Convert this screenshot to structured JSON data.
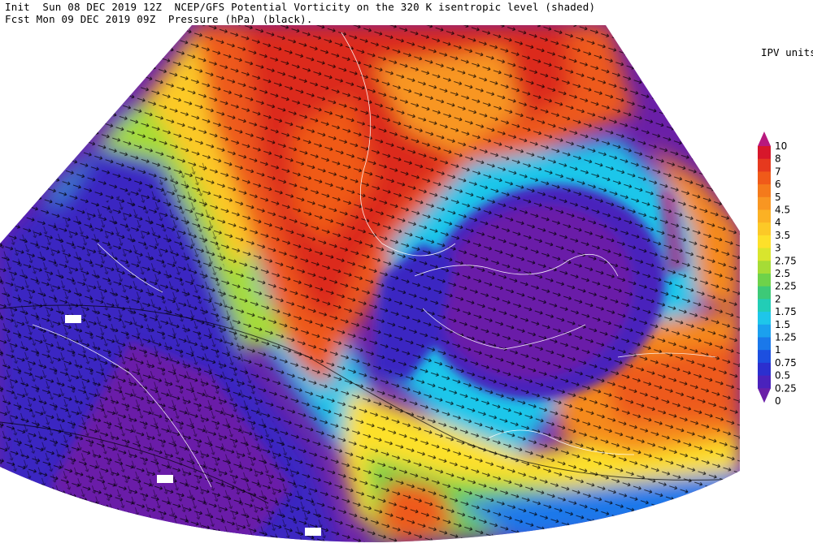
{
  "header": {
    "line1": "Init  Sun 08 DEC 2019 12Z  NCEP/GFS Potential Vorticity on the 320 K isentropic level (shaded)",
    "line2": "Fcst Mon 09 DEC 2019 09Z  Pressure (hPa) (black)."
  },
  "colorbar": {
    "units_label": "IPV units",
    "levels": [
      {
        "label": "10",
        "color": "#b8197e"
      },
      {
        "label": "8",
        "color": "#d7172b"
      },
      {
        "label": "7",
        "color": "#e6391e"
      },
      {
        "label": "6",
        "color": "#f05a19"
      },
      {
        "label": "5",
        "color": "#f47a1b"
      },
      {
        "label": "4.5",
        "color": "#f89622"
      },
      {
        "label": "4",
        "color": "#fbb124"
      },
      {
        "label": "3.5",
        "color": "#fcc927"
      },
      {
        "label": "3",
        "color": "#fde02a"
      },
      {
        "label": "2.75",
        "color": "#d9e52d"
      },
      {
        "label": "2.5",
        "color": "#a6dc36"
      },
      {
        "label": "2.25",
        "color": "#6ed24a"
      },
      {
        "label": "2",
        "color": "#3dc977"
      },
      {
        "label": "1.75",
        "color": "#22cdb6"
      },
      {
        "label": "1.5",
        "color": "#1ec6ea"
      },
      {
        "label": "1.25",
        "color": "#1ba0ee"
      },
      {
        "label": "1",
        "color": "#1a78ea"
      },
      {
        "label": "0.75",
        "color": "#1c4fe0"
      },
      {
        "label": "0.5",
        "color": "#2b2fcf"
      },
      {
        "label": "0.25",
        "color": "#4a22bc"
      },
      {
        "label": "0",
        "color": "#6a1fa8"
      }
    ]
  },
  "map": {
    "colors": {
      "violet": "#6a1fa8",
      "deep_blue": "#3b28c2",
      "blue": "#1a78ea",
      "cyan": "#1ec6ea",
      "green": "#6ed24a",
      "yellow": "#fde02a",
      "orange": "#f58a1e",
      "red_orange": "#ee5a1a",
      "red": "#dc2a1c",
      "crimson": "#b8197e",
      "vectors": "#000000",
      "coastline": "#ffffff"
    },
    "icons": [
      "wind-vector-arrows",
      "pressure-contours",
      "coastlines",
      "pressure-labels"
    ]
  }
}
